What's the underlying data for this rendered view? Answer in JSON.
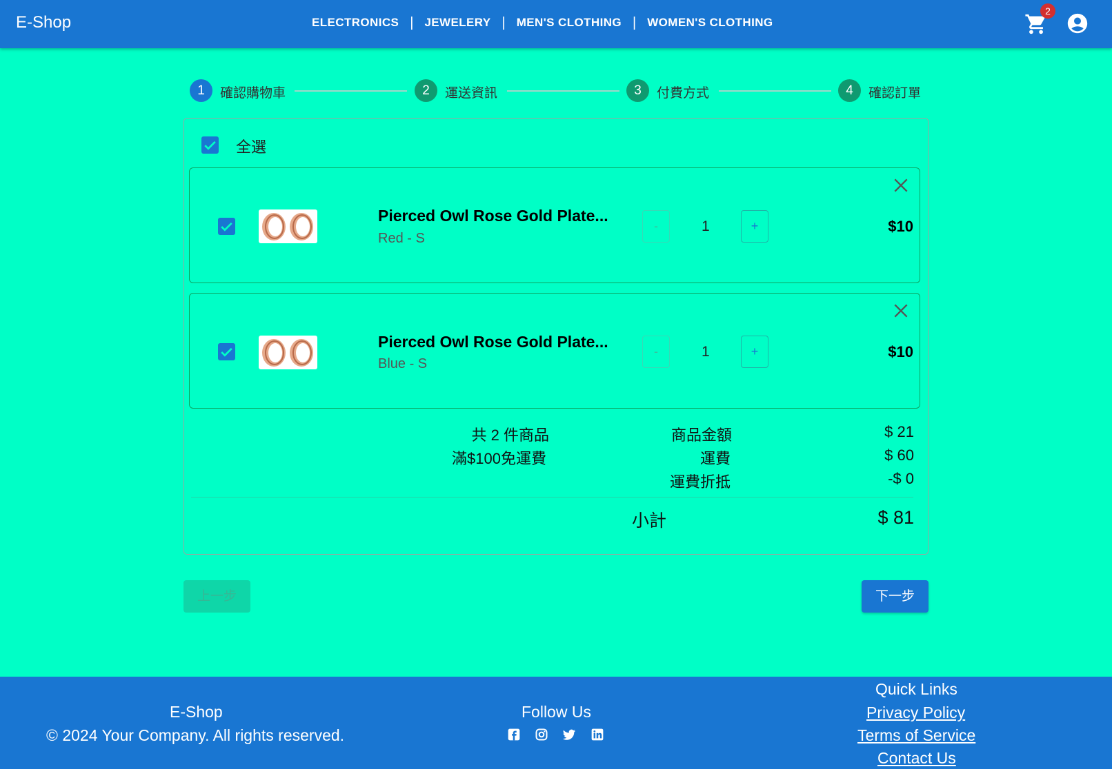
{
  "header": {
    "brand": "E-Shop",
    "nav": [
      "ELECTRONICS",
      "JEWELERY",
      "MEN'S CLOTHING",
      "WOMEN'S CLOTHING"
    ],
    "cart_badge": "2",
    "cart_icon": "shopping-cart-icon",
    "account_icon": "account-circle-icon"
  },
  "stepper": {
    "steps": [
      {
        "num": "1",
        "label": "確認購物車",
        "active": true
      },
      {
        "num": "2",
        "label": "運送資訊",
        "active": false
      },
      {
        "num": "3",
        "label": "付費方式",
        "active": false
      },
      {
        "num": "4",
        "label": "確認訂單",
        "active": false
      }
    ]
  },
  "cart": {
    "select_all_label": "全選",
    "items": [
      {
        "name": "Pierced Owl Rose Gold Plate...",
        "variant": "Red - S",
        "qty": "1",
        "price": "$10",
        "minus": "-",
        "plus": "+",
        "checked": true
      },
      {
        "name": "Pierced Owl Rose Gold Plate...",
        "variant": "Blue - S",
        "qty": "1",
        "price": "$10",
        "minus": "-",
        "plus": "+",
        "checked": true
      }
    ],
    "summary": {
      "count_text": "共 2 件商品",
      "free_shipping_text": "滿$100免運費",
      "subtotal_label": "商品金額",
      "subtotal_value": "$ 21",
      "shipping_label": "運費",
      "shipping_value": "$ 60",
      "discount_label": "運費折抵",
      "discount_value": "-$ 0",
      "total_label": "小計",
      "total_value": "$ 81"
    }
  },
  "buttons": {
    "prev": "上一步",
    "next": "下一步"
  },
  "footer": {
    "brand": "E-Shop",
    "copyright": "© 2024 Your Company. All rights reserved.",
    "follow_title": "Follow Us",
    "social_icons": [
      "facebook-icon",
      "instagram-icon",
      "twitter-icon",
      "linkedin-icon"
    ],
    "links_title": "Quick Links",
    "links": [
      "Privacy Policy",
      "Terms of Service",
      "Contact Us"
    ]
  },
  "colors": {
    "primary": "#1976d2",
    "background": "#00ffc6",
    "step_inactive": "#0f9a70",
    "badge": "#d32f2f"
  }
}
